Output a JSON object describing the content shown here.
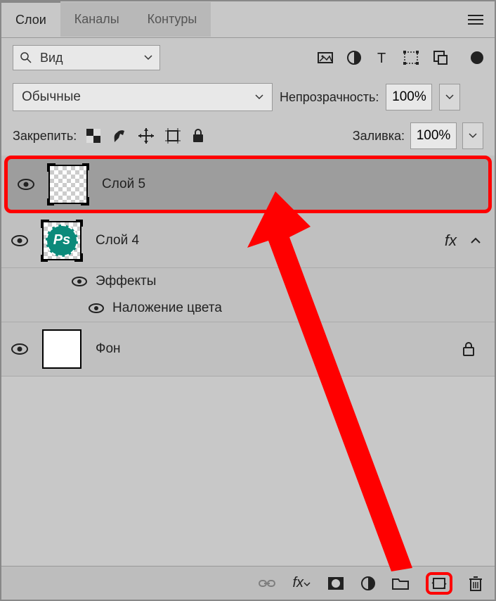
{
  "tabs": {
    "layers": "Слои",
    "channels": "Каналы",
    "paths": "Контуры"
  },
  "filter": {
    "label": "Вид"
  },
  "blend": {
    "mode": "Обычные",
    "opacity_label": "Непрозрачность:",
    "opacity_value": "100%"
  },
  "lock": {
    "label": "Закрепить:",
    "fill_label": "Заливка:",
    "fill_value": "100%"
  },
  "layers": [
    {
      "name": "Слой 5",
      "highlighted": true
    },
    {
      "name": "Слой 4",
      "fx": true
    },
    {
      "name": "Фон",
      "locked": true
    }
  ],
  "effects": {
    "title": "Эффекты",
    "items": [
      "Наложение цвета"
    ]
  },
  "ps_badge": "Ps"
}
